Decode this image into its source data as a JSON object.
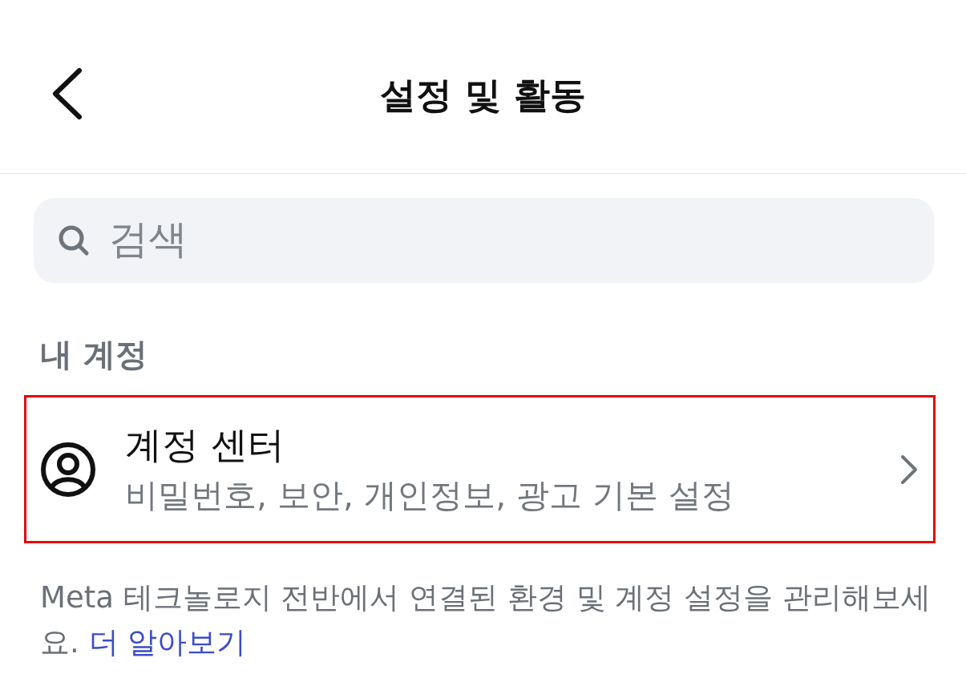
{
  "header": {
    "title": "설정 및 활동"
  },
  "search": {
    "placeholder": "검색"
  },
  "section": {
    "title": "내 계정"
  },
  "account_center": {
    "title": "계정 센터",
    "subtitle": "비밀번호, 보안, 개인정보, 광고 기본 설정",
    "highlighted": true
  },
  "description": {
    "text": "Meta 테크놀로지 전반에서 연결된 환경 및 계정 설정을 관리해보세요.",
    "link": "더 알아보기"
  }
}
